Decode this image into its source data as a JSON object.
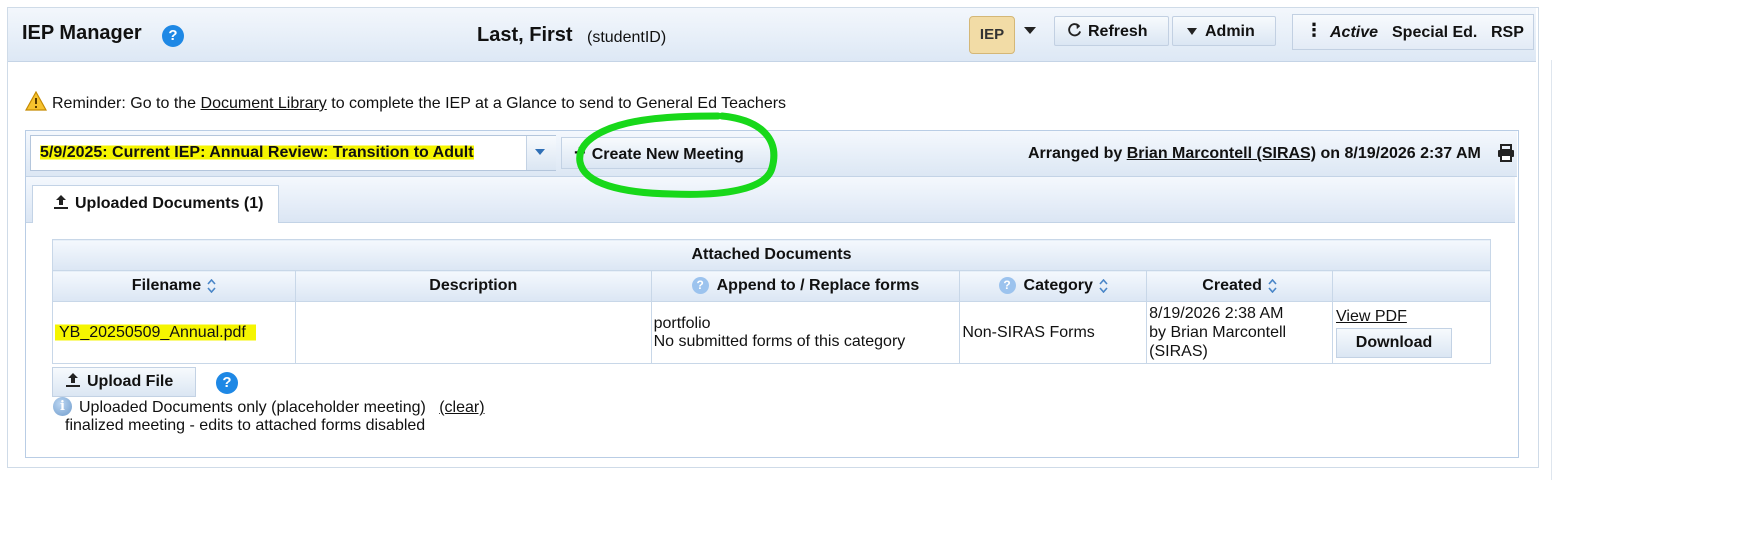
{
  "header": {
    "app_title": "IEP Manager",
    "help": "?",
    "student_name": "Last, First",
    "student_id": "(studentID)",
    "iep_label": "IEP",
    "refresh_label": "Refresh",
    "admin_label": "Admin",
    "status_active": "Active",
    "status_program": "Special Ed.",
    "status_rsp": "RSP"
  },
  "reminder": {
    "prefix": "Reminder: Go to the ",
    "link": "Document Library",
    "suffix": " to complete the IEP at a Glance to send to General Ed Teachers"
  },
  "meeting": {
    "selected": "5/9/2025: Current IEP: Annual Review: Transition to Adult",
    "create_label": "Create New Meeting",
    "arranged_prefix": "Arranged by ",
    "arranged_by": "Brian Marcontell (SIRAS)",
    "arranged_suffix": " on 8/19/2026 2:37 AM"
  },
  "tabs": [
    {
      "label": "Uploaded Documents (1)"
    }
  ],
  "table": {
    "caption": "Attached Documents",
    "columns": [
      "Filename",
      "Description",
      "Append to / Replace forms",
      "Category",
      "Created",
      ""
    ],
    "rows": [
      {
        "filename": "YB_20250509_Annual.pdf",
        "description": "",
        "append_line1": "portfolio",
        "append_line2": "No submitted forms of this category",
        "category": "Non-SIRAS Forms",
        "created_line1": "8/19/2026 2:38 AM",
        "created_line2": "by Brian Marcontell",
        "created_line3": "(SIRAS)",
        "view_label": "View PDF",
        "download_label": "Download"
      }
    ]
  },
  "footer": {
    "upload_label": "Upload File",
    "info_text": "Uploaded Documents only (placeholder meeting)",
    "clear_label": "(clear)",
    "finalized_text": "finalized meeting - edits to attached forms disabled"
  },
  "colors": {
    "annotation_green": "#18d81a",
    "highlight_yellow": "#f5f500",
    "accent_blue": "#1e88e5"
  }
}
